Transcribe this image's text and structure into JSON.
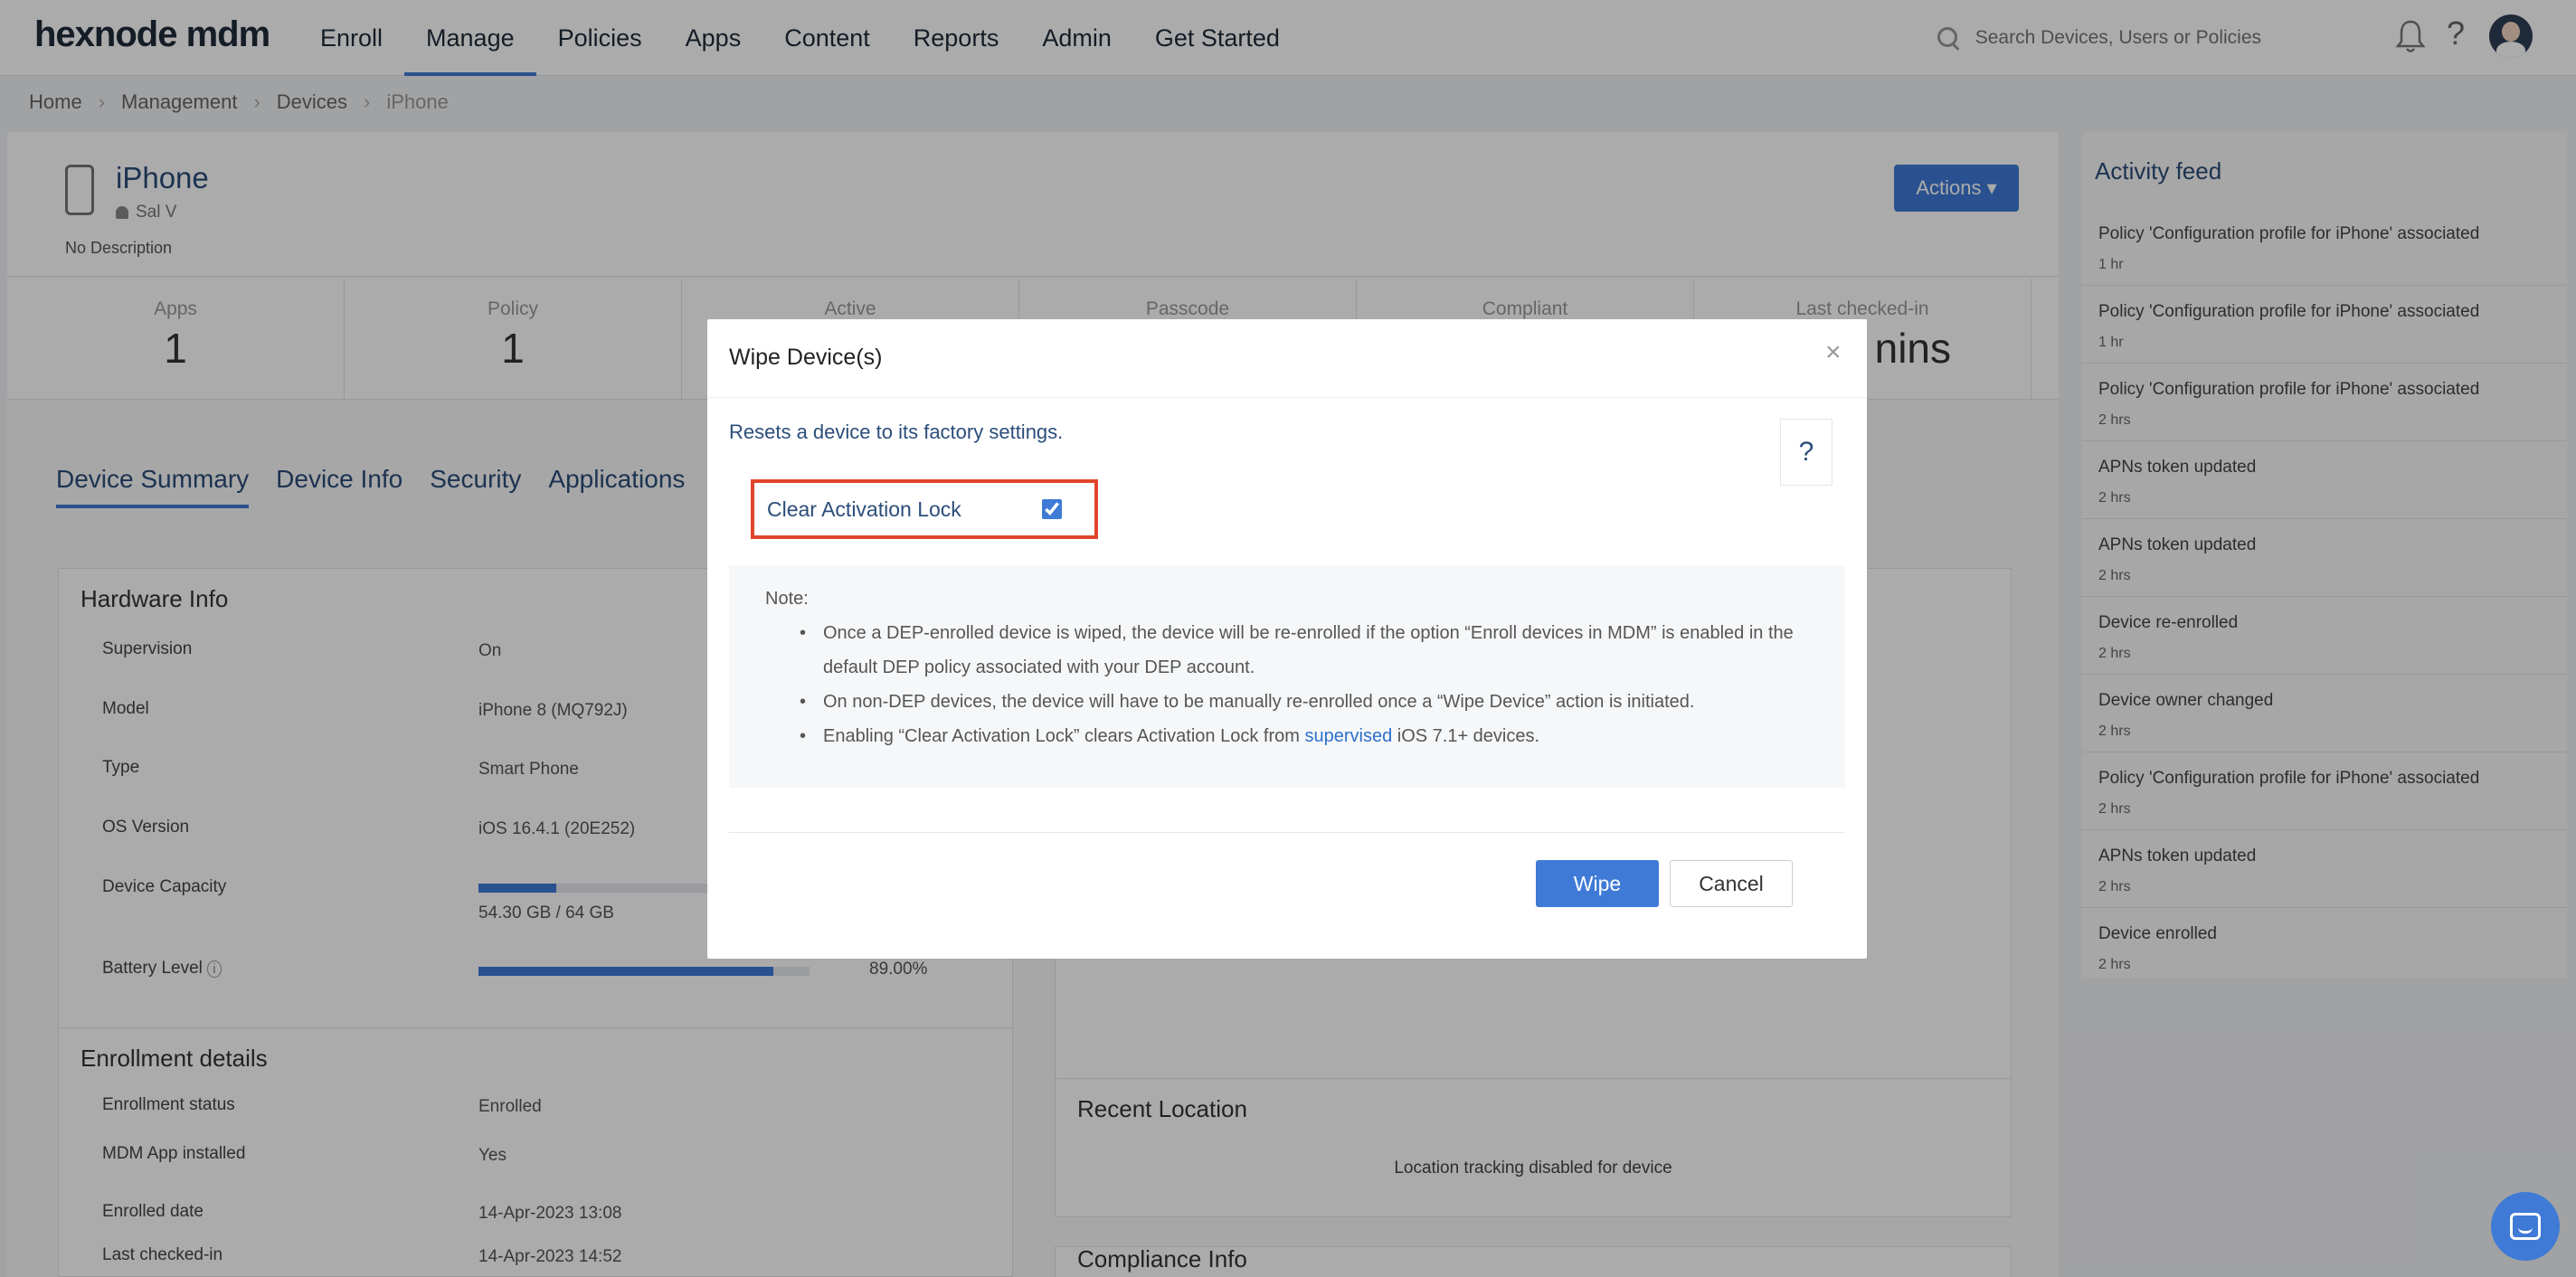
{
  "nav": {
    "logo": "hexnode mdm",
    "items": [
      "Enroll",
      "Manage",
      "Policies",
      "Apps",
      "Content",
      "Reports",
      "Admin",
      "Get Started"
    ],
    "active": "Manage",
    "search_placeholder": "Search Devices, Users or Policies",
    "help": "?"
  },
  "breadcrumb": [
    "Home",
    "Management",
    "Devices",
    "iPhone"
  ],
  "device": {
    "name": "iPhone",
    "owner": "Sal V",
    "description": "No Description",
    "actions_label": "Actions ▾"
  },
  "stats": [
    {
      "label": "Apps",
      "value": "1"
    },
    {
      "label": "Policy",
      "value": "1"
    },
    {
      "label": "Active",
      "value": ""
    },
    {
      "label": "Passcode",
      "value": ""
    },
    {
      "label": "Compliant",
      "value": ""
    },
    {
      "label": "Last checked-in",
      "value": "nins"
    }
  ],
  "tabs": [
    "Device Summary",
    "Device Info",
    "Security",
    "Applications"
  ],
  "hardware": {
    "title": "Hardware Info",
    "supervision_label": "Supervision",
    "supervision_value": "On",
    "model_label": "Model",
    "model_value": "iPhone 8 (MQ792J)",
    "type_label": "Type",
    "type_value": "Smart Phone",
    "os_label": "OS Version",
    "os_value": "iOS 16.4.1 (20E252)",
    "capacity_label": "Device Capacity",
    "capacity_value": "54.30 GB / 64 GB",
    "capacity_fraction": 0.18,
    "battery_label": "Battery Level",
    "battery_value": "89.00%",
    "battery_fraction": 0.89
  },
  "enrollment": {
    "title": "Enrollment details",
    "status_label": "Enrollment status",
    "status_value": "Enrolled",
    "app_label": "MDM App installed",
    "app_value": "Yes",
    "date_label": "Enrolled date",
    "date_value": "14-Apr-2023 13:08",
    "checked_label": "Last checked-in",
    "checked_value": "14-Apr-2023 14:52"
  },
  "location": {
    "title": "Recent Location",
    "message": "Location tracking disabled for device",
    "next_title": "Compliance Info"
  },
  "feed": {
    "title": "Activity feed",
    "items": [
      {
        "text": "Policy 'Configuration profile for iPhone' associated",
        "time": "1 hr"
      },
      {
        "text": "Policy 'Configuration profile for iPhone' associated",
        "time": "1 hr"
      },
      {
        "text": "Policy 'Configuration profile for iPhone' associated",
        "time": "2 hrs"
      },
      {
        "text": "APNs token updated",
        "time": "2 hrs"
      },
      {
        "text": "APNs token updated",
        "time": "2 hrs"
      },
      {
        "text": "Device re-enrolled",
        "time": "2 hrs"
      },
      {
        "text": "Device owner changed",
        "time": "2 hrs"
      },
      {
        "text": "Policy 'Configuration profile for iPhone' associated",
        "time": "2 hrs"
      },
      {
        "text": "APNs token updated",
        "time": "2 hrs"
      },
      {
        "text": "Device enrolled",
        "time": "2 hrs"
      }
    ]
  },
  "modal": {
    "title": "Wipe Device(s)",
    "close": "×",
    "description": "Resets a device to its factory settings.",
    "help": "?",
    "clear_activation_label": "Clear Activation Lock",
    "clear_activation_checked": true,
    "note_title": "Note:",
    "note_1": "Once a DEP-enrolled device is wiped, the device will be re-enrolled if the option “Enroll devices in MDM” is enabled in the default DEP policy associated with your DEP account.",
    "note_2": "On non-DEP devices, the device will have to be manually re-enrolled once a “Wipe Device” action is initiated.",
    "note_3_pre": "Enabling “Clear Activation Lock” clears Activation Lock from ",
    "note_3_link": "supervised",
    "note_3_post": " iOS 7.1+ devices.",
    "wipe_label": "Wipe",
    "cancel_label": "Cancel"
  },
  "colors": {
    "accent": "#3f7ad6",
    "highlight": "#e0452b",
    "link": "#2e6fc9"
  }
}
